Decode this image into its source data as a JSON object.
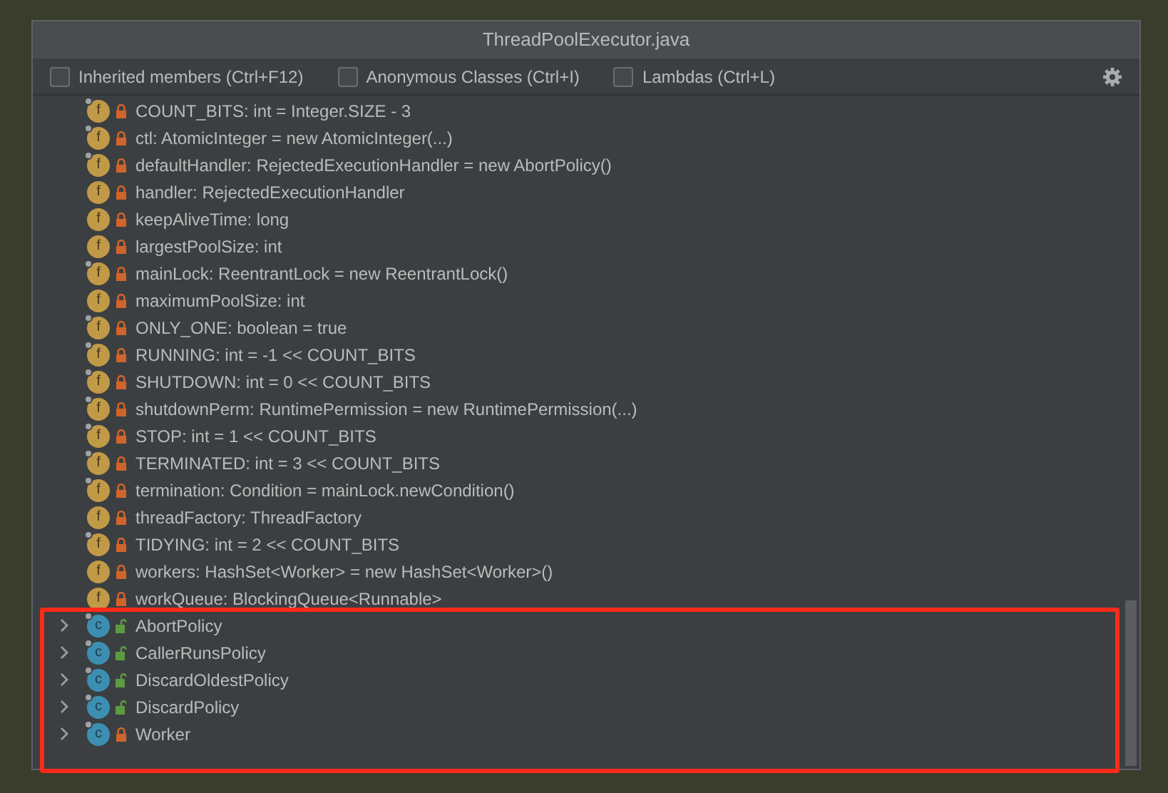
{
  "window": {
    "title": "ThreadPoolExecutor.java"
  },
  "options": [
    {
      "label": "Inherited members (Ctrl+F12)",
      "checked": false
    },
    {
      "label": "Anonymous Classes (Ctrl+I)",
      "checked": false
    },
    {
      "label": "Lambdas (Ctrl+L)",
      "checked": false
    }
  ],
  "members": [
    {
      "kind": "field",
      "badge": "f",
      "static": true,
      "locked": true,
      "text": "COUNT_BITS: int = Integer.SIZE - 3"
    },
    {
      "kind": "field",
      "badge": "f",
      "static": true,
      "locked": true,
      "text": "ctl: AtomicInteger = new AtomicInteger(...)"
    },
    {
      "kind": "field",
      "badge": "f",
      "static": true,
      "locked": true,
      "text": "defaultHandler: RejectedExecutionHandler = new AbortPolicy()"
    },
    {
      "kind": "field",
      "badge": "f",
      "static": false,
      "locked": true,
      "text": "handler: RejectedExecutionHandler"
    },
    {
      "kind": "field",
      "badge": "f",
      "static": false,
      "locked": true,
      "text": "keepAliveTime: long"
    },
    {
      "kind": "field",
      "badge": "f",
      "static": false,
      "locked": true,
      "text": "largestPoolSize: int"
    },
    {
      "kind": "field",
      "badge": "f",
      "static": true,
      "locked": true,
      "text": "mainLock: ReentrantLock = new ReentrantLock()"
    },
    {
      "kind": "field",
      "badge": "f",
      "static": false,
      "locked": true,
      "text": "maximumPoolSize: int"
    },
    {
      "kind": "field",
      "badge": "f",
      "static": true,
      "locked": true,
      "text": "ONLY_ONE: boolean = true"
    },
    {
      "kind": "field",
      "badge": "f",
      "static": true,
      "locked": true,
      "text": "RUNNING: int = -1 << COUNT_BITS"
    },
    {
      "kind": "field",
      "badge": "f",
      "static": true,
      "locked": true,
      "text": "SHUTDOWN: int = 0 << COUNT_BITS"
    },
    {
      "kind": "field",
      "badge": "f",
      "static": true,
      "locked": true,
      "text": "shutdownPerm: RuntimePermission = new RuntimePermission(...)"
    },
    {
      "kind": "field",
      "badge": "f",
      "static": true,
      "locked": true,
      "text": "STOP: int = 1 << COUNT_BITS"
    },
    {
      "kind": "field",
      "badge": "f",
      "static": true,
      "locked": true,
      "text": "TERMINATED: int = 3 << COUNT_BITS"
    },
    {
      "kind": "field",
      "badge": "f",
      "static": true,
      "locked": true,
      "text": "termination: Condition = mainLock.newCondition()"
    },
    {
      "kind": "field",
      "badge": "f",
      "static": false,
      "locked": true,
      "text": "threadFactory: ThreadFactory"
    },
    {
      "kind": "field",
      "badge": "f",
      "static": true,
      "locked": true,
      "text": "TIDYING: int = 2 << COUNT_BITS"
    },
    {
      "kind": "field",
      "badge": "f",
      "static": false,
      "locked": true,
      "text": "workers: HashSet<Worker> = new HashSet<Worker>()"
    },
    {
      "kind": "field",
      "badge": "f",
      "static": false,
      "locked": true,
      "text": "workQueue: BlockingQueue<Runnable>"
    },
    {
      "kind": "class",
      "badge": "c",
      "static": true,
      "locked": false,
      "expanded": false,
      "text": "AbortPolicy"
    },
    {
      "kind": "class",
      "badge": "c",
      "static": true,
      "locked": false,
      "expanded": false,
      "text": "CallerRunsPolicy"
    },
    {
      "kind": "class",
      "badge": "c",
      "static": true,
      "locked": false,
      "expanded": false,
      "text": "DiscardOldestPolicy"
    },
    {
      "kind": "class",
      "badge": "c",
      "static": true,
      "locked": false,
      "expanded": false,
      "text": "DiscardPolicy"
    },
    {
      "kind": "class",
      "badge": "c",
      "static": true,
      "locked": true,
      "expanded": false,
      "text": "Worker"
    }
  ]
}
